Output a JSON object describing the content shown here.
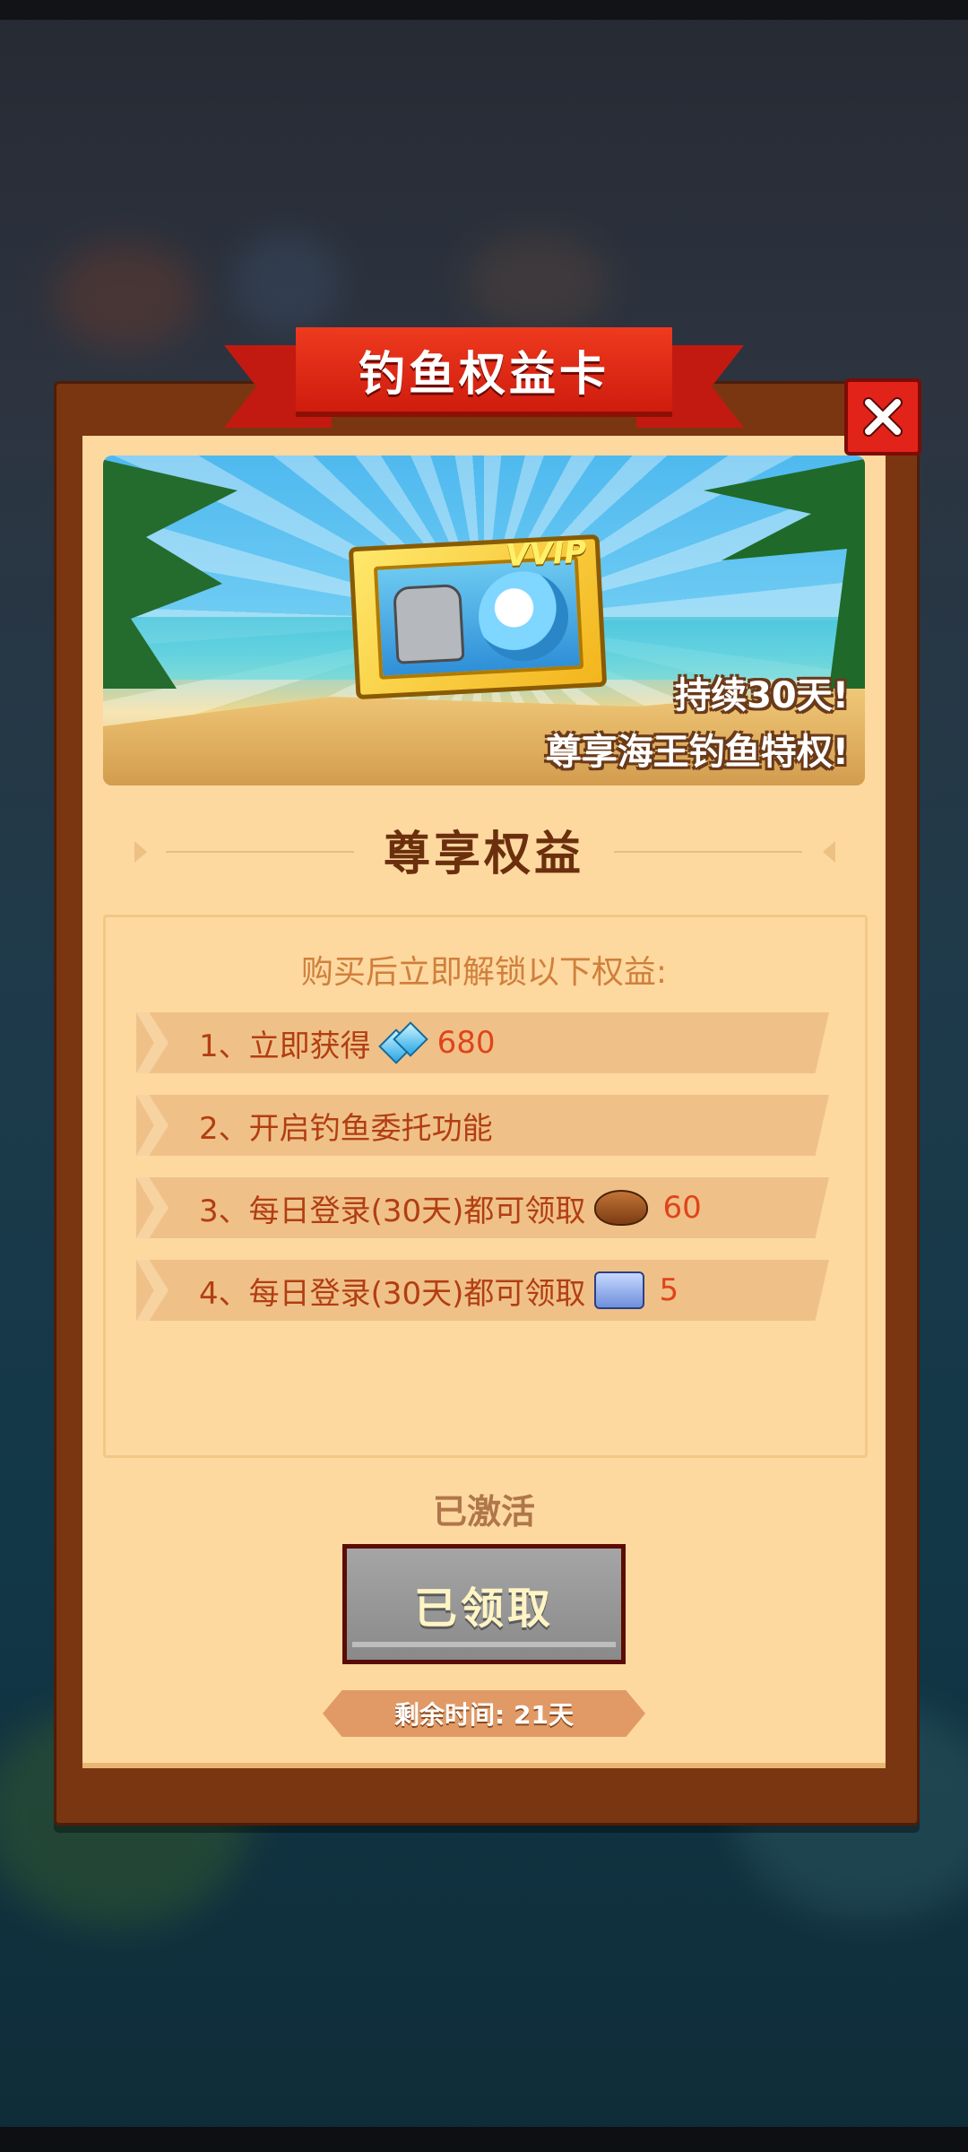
{
  "dialog": {
    "title": "钓鱼权益卡",
    "close_icon": "close-x-icon"
  },
  "banner": {
    "badge": "VVIP",
    "line1": "持续30天!",
    "line2": "尊享海王钓鱼特权!"
  },
  "section": {
    "title": "尊享权益"
  },
  "benefits": {
    "intro": "购买后立即解锁以下权益:",
    "items": [
      {
        "label": "1、立即获得",
        "icon": "diamond-icon",
        "value": "680"
      },
      {
        "label": "2、开启钓鱼委托功能",
        "icon": "",
        "value": ""
      },
      {
        "label": "3、每日登录(30天)都可领取",
        "icon": "bread-icon",
        "value": "60"
      },
      {
        "label": "4、每日登录(30天)都可领取",
        "icon": "ticket-icon",
        "value": "5"
      }
    ]
  },
  "status": {
    "activated": "已激活",
    "claim_button": "已领取",
    "remaining": "剩余时间: 21天"
  },
  "colors": {
    "ribbon": "#cf1c0e",
    "frame": "#7a3610",
    "panel": "#fdd9a0",
    "value_text": "#e0441a"
  }
}
